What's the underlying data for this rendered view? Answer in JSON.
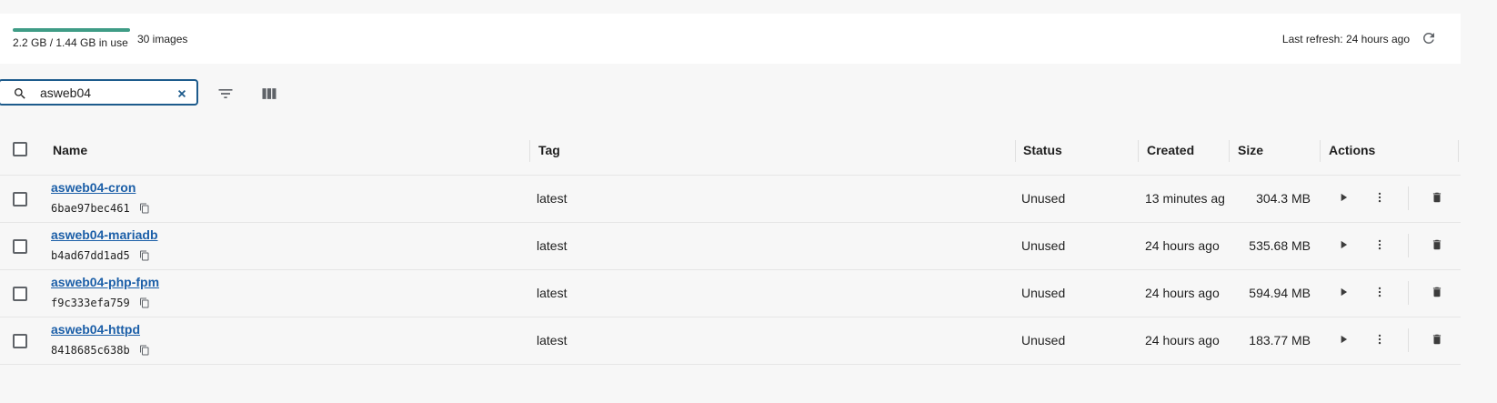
{
  "header": {
    "usage_text": "2.2 GB / 1.44 GB in use",
    "usage_fraction": 1.0,
    "image_count": "30 images",
    "last_refresh": "Last refresh: 24 hours ago"
  },
  "search": {
    "value": "asweb04",
    "placeholder": "Search"
  },
  "table": {
    "columns": {
      "name": "Name",
      "tag": "Tag",
      "status": "Status",
      "created": "Created",
      "size": "Size",
      "actions": "Actions"
    },
    "rows": [
      {
        "name": "asweb04-cron",
        "id": "6bae97bec461",
        "tag": "latest",
        "status": "Unused",
        "created": "13 minutes ag",
        "size": "304.3 MB"
      },
      {
        "name": "asweb04-mariadb",
        "id": "b4ad67dd1ad5",
        "tag": "latest",
        "status": "Unused",
        "created": "24 hours ago",
        "size": "535.68 MB"
      },
      {
        "name": "asweb04-php-fpm",
        "id": "f9c333efa759",
        "tag": "latest",
        "status": "Unused",
        "created": "24 hours ago",
        "size": "594.94 MB"
      },
      {
        "name": "asweb04-httpd",
        "id": "8418685c638b",
        "tag": "latest",
        "status": "Unused",
        "created": "24 hours ago",
        "size": "183.77 MB"
      }
    ]
  },
  "icons": {
    "search": "search-icon",
    "clear": "close-icon",
    "filter": "filter-icon",
    "columns": "columns-icon",
    "refresh": "refresh-icon",
    "copy": "copy-icon",
    "run": "play-icon",
    "more": "more-vert-icon",
    "delete": "trash-icon"
  },
  "colors": {
    "accent": "#1d5b8c",
    "link": "#1c5fa8",
    "usage_fill": "#3f9c86"
  }
}
